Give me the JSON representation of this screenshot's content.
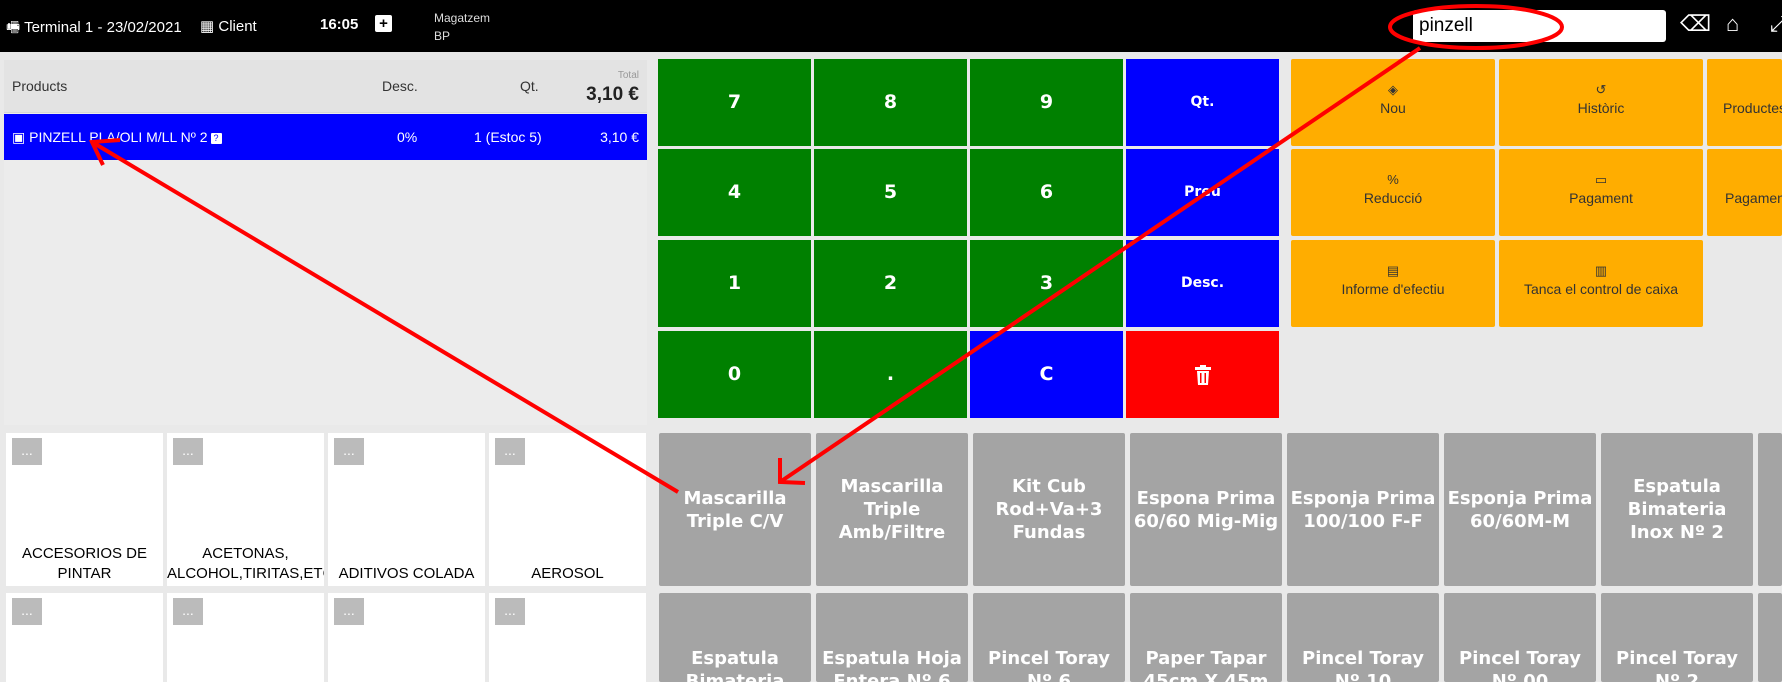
{
  "topbar": {
    "terminal": "Terminal 1 - 23/02/2021",
    "client": "Client",
    "time": "16:05",
    "store_label": "Magatzem",
    "store_value": "BP",
    "search_value": "pinzell"
  },
  "ticket": {
    "col_products": "Products",
    "col_desc": "Desc.",
    "col_qt": "Qt.",
    "total_label": "Total",
    "total_value": "3,10 €",
    "lines": [
      {
        "name": "PINZELL PLA/OLI M/LL Nº 2",
        "desc": "0%",
        "qt": "1 (Estoc 5)",
        "total": "3,10 €"
      }
    ]
  },
  "keypad": {
    "k7": "7",
    "k8": "8",
    "k9": "9",
    "qt": "Qt.",
    "k4": "4",
    "k5": "5",
    "k6": "6",
    "price": "Preu",
    "k1": "1",
    "k2": "2",
    "k3": "3",
    "desc": "Desc.",
    "k0": "0",
    "dot": ".",
    "clear": "C"
  },
  "actions": {
    "nou": "Nou",
    "historic": "Històric",
    "products": "Productes",
    "reduccio": "Reducció",
    "pagament": "Pagament",
    "pagament2": "Pagaments",
    "informe": "Informe d'efectiu",
    "tanca": "Tanca el control de caixa"
  },
  "categories": [
    "ACCESORIOS DE\nPINTAR",
    "ACETONAS,\nALCOHOL,TIRITAS,ETC",
    "ADITIVOS COLADA",
    "AEROSOL",
    "",
    "",
    "",
    ""
  ],
  "category_more": "...",
  "products": [
    "Mascarilla Triple C/V",
    "Mascarilla Triple Amb/Filtre",
    "Kit Cub Rod+Va+3 Fundas",
    "Espona Prima 60/60 Mig-Mig",
    "Esponja Prima 100/100 F-F",
    "Esponja Prima 60/60M-M",
    "Espatula Bimateria Inox Nº 2",
    "Espatula Bimateria",
    "Espatula Hoja Entera Nº 6",
    "Pincel Toray Nº 6",
    "Paper Tapar 45cm X 45m",
    "Pincel Toray Nº 10",
    "Pincel Toray Nº 00",
    "Pincel Toray Nº 2"
  ],
  "colors": {
    "keypad_green": "#008000",
    "keypad_blue": "#0000ff",
    "keypad_red": "#ff0000",
    "action_orange": "#ffad00",
    "product_gray": "#a4a4a4",
    "annotation_red": "#ff0000"
  }
}
